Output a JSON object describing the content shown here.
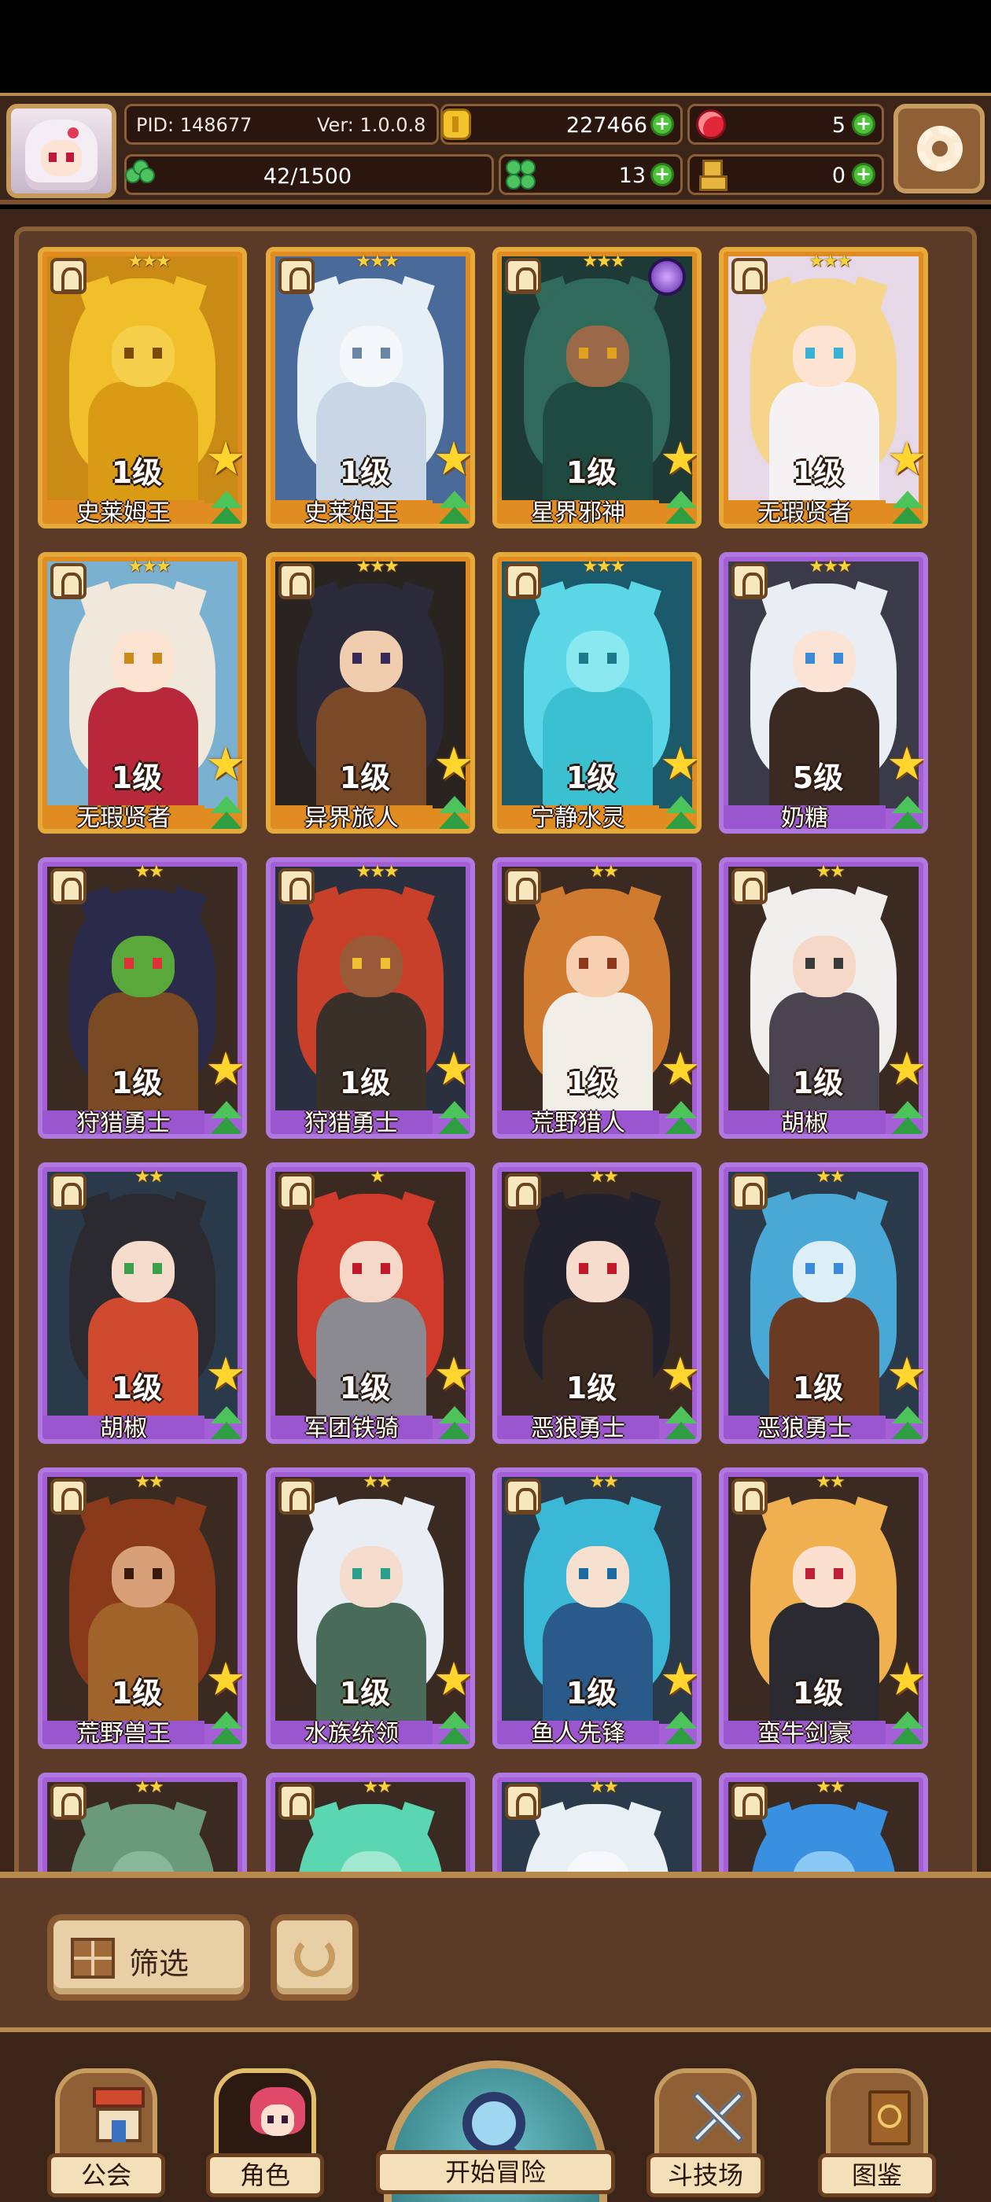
{
  "header": {
    "pid": "PID: 148677",
    "version": "Ver: 1.0.0.8",
    "gold": "227466",
    "gems": "5",
    "capacity": "42/1500",
    "clover": "13",
    "boots": "0"
  },
  "heroes": [
    {
      "name": "史莱姆王",
      "level": "1级",
      "stars": "★★★",
      "rarity": "gold",
      "palette": {
        "bg": "#c98a16",
        "hair": "#f1bf2a",
        "skin": "#f6cf4a",
        "body": "#d99a14",
        "eye": "#7a4a08"
      }
    },
    {
      "name": "史莱姆王",
      "level": "1级",
      "stars": "★★★",
      "rarity": "gold",
      "palette": {
        "bg": "#4a6a9a",
        "hair": "#e6eef6",
        "skin": "#f4f8fb",
        "body": "#c8d6e6",
        "eye": "#6a86a6"
      }
    },
    {
      "name": "星界邪神",
      "level": "1级",
      "stars": "★★★",
      "rarity": "gold",
      "palette": {
        "bg": "#1e3a36",
        "hair": "#2f6a5a",
        "skin": "#9a6a48",
        "body": "#1f4a40",
        "eye": "#e0a020"
      }
    },
    {
      "name": "无瑕贤者",
      "level": "1级",
      "stars": "★★★",
      "rarity": "gold",
      "palette": {
        "bg": "#e6d8e6",
        "hair": "#f6d58a",
        "skin": "#fde4d2",
        "body": "#f6f2f4",
        "eye": "#3ab0d6"
      }
    },
    {
      "name": "无瑕贤者",
      "level": "1级",
      "stars": "★★★",
      "rarity": "gold",
      "palette": {
        "bg": "#7ab0d0",
        "hair": "#f1e8dc",
        "skin": "#fde4d2",
        "body": "#b8283a",
        "eye": "#c88a1a"
      }
    },
    {
      "name": "异界旅人",
      "level": "1级",
      "stars": "★★★",
      "rarity": "gold",
      "palette": {
        "bg": "#2a2420",
        "hair": "#2a2a3a",
        "skin": "#f1cdb0",
        "body": "#7a4a28",
        "eye": "#3a2a5a"
      }
    },
    {
      "name": "宁静水灵",
      "level": "1级",
      "stars": "★★★",
      "rarity": "gold",
      "palette": {
        "bg": "#1a5a6a",
        "hair": "#5ad6e6",
        "skin": "#8ae8f0",
        "body": "#3ac0d0",
        "eye": "#1a7a8a"
      }
    },
    {
      "name": "奶糖",
      "level": "5级",
      "stars": "★★★",
      "rarity": "purple",
      "palette": {
        "bg": "#3a3a48",
        "hair": "#e8eef4",
        "skin": "#fbe4d6",
        "body": "#3a2a22",
        "eye": "#3a8ad6"
      }
    },
    {
      "name": "狩猎勇士",
      "level": "1级",
      "stars": "★★",
      "rarity": "purple",
      "palette": {
        "bg": "#3a2a22",
        "hair": "#2a2a4a",
        "skin": "#5aa83a",
        "body": "#7a4a22",
        "eye": "#e0303a"
      }
    },
    {
      "name": "狩猎勇士",
      "level": "1级",
      "stars": "★★★",
      "rarity": "purple",
      "palette": {
        "bg": "#2a3040",
        "hair": "#c8402a",
        "skin": "#9a5a38",
        "body": "#3a302a",
        "eye": "#f0c030"
      }
    },
    {
      "name": "荒野猎人",
      "level": "1级",
      "stars": "★★",
      "rarity": "purple",
      "palette": {
        "bg": "#3a2a22",
        "hair": "#d07a30",
        "skin": "#f6d0b0",
        "body": "#f1eee8",
        "eye": "#8a3a1a"
      }
    },
    {
      "name": "胡椒",
      "level": "1级",
      "stars": "★★",
      "rarity": "purple",
      "palette": {
        "bg": "#3a2a22",
        "hair": "#f1eeee",
        "skin": "#f6d8c8",
        "body": "#4a4450",
        "eye": "#3a3a3a"
      }
    },
    {
      "name": "胡椒",
      "level": "1级",
      "stars": "★★",
      "rarity": "purple",
      "palette": {
        "bg": "#2a3a4a",
        "hair": "#2a2a30",
        "skin": "#f6dccc",
        "body": "#d04a30",
        "eye": "#3aa04a"
      }
    },
    {
      "name": "军团铁骑",
      "level": "1级",
      "stars": "★",
      "rarity": "purple",
      "palette": {
        "bg": "#3a2a22",
        "hair": "#d03a2a",
        "skin": "#f6d8c8",
        "body": "#8a8a90",
        "eye": "#c01a2a"
      }
    },
    {
      "name": "恶狼勇士",
      "level": "1级",
      "stars": "★★",
      "rarity": "purple",
      "palette": {
        "bg": "#3a2a22",
        "hair": "#22222e",
        "skin": "#f6dccc",
        "body": "#3a2a22",
        "eye": "#c01a2a"
      }
    },
    {
      "name": "恶狼勇士",
      "level": "1级",
      "stars": "★★",
      "rarity": "purple",
      "palette": {
        "bg": "#2a3a4a",
        "hair": "#4aa8d6",
        "skin": "#dceef6",
        "body": "#6a3a22",
        "eye": "#3a8ad6"
      }
    },
    {
      "name": "荒野兽王",
      "level": "1级",
      "stars": "★★",
      "rarity": "purple",
      "palette": {
        "bg": "#3a2a22",
        "hair": "#8a3a1a",
        "skin": "#d8a078",
        "body": "#a0642a",
        "eye": "#3a1a0a"
      }
    },
    {
      "name": "水族统领",
      "level": "1级",
      "stars": "★★",
      "rarity": "purple",
      "palette": {
        "bg": "#3a2a22",
        "hair": "#e8eef4",
        "skin": "#f6dccc",
        "body": "#4a6a5a",
        "eye": "#2aa08a"
      }
    },
    {
      "name": "鱼人先锋",
      "level": "1级",
      "stars": "★★",
      "rarity": "purple",
      "palette": {
        "bg": "#2a3a4a",
        "hair": "#3ab8d6",
        "skin": "#f6e0d0",
        "body": "#2a5a8a",
        "eye": "#1a6aa0"
      }
    },
    {
      "name": "蛮牛剑豪",
      "level": "1级",
      "stars": "★★",
      "rarity": "purple",
      "palette": {
        "bg": "#3a2a22",
        "hair": "#f0b050",
        "skin": "#fbe0d0",
        "body": "#2a2a30",
        "eye": "#c0203a"
      }
    },
    {
      "name": "",
      "level": "",
      "stars": "★★",
      "rarity": "purple",
      "palette": {
        "bg": "#3a2a22",
        "hair": "#6a9a7a",
        "skin": "#8ab89a",
        "body": "#4a7a5a",
        "eye": "#2a4a3a"
      }
    },
    {
      "name": "",
      "level": "",
      "stars": "★★",
      "rarity": "purple",
      "palette": {
        "bg": "#3a2a22",
        "hair": "#5ad6b0",
        "skin": "#a0e8d0",
        "body": "#3ab090",
        "eye": "#1a6a5a"
      }
    },
    {
      "name": "",
      "level": "",
      "stars": "★★",
      "rarity": "purple",
      "palette": {
        "bg": "#2a3a4a",
        "hair": "#e8f0f6",
        "skin": "#f6f8fb",
        "body": "#c8d8e6",
        "eye": "#4a6a8a"
      }
    },
    {
      "name": "",
      "level": "",
      "stars": "★★",
      "rarity": "purple",
      "palette": {
        "bg": "#3a2a22",
        "hair": "#3a90e0",
        "skin": "#8ac8f6",
        "body": "#2a70c0",
        "eye": "#1a3a6a"
      }
    }
  ],
  "toolbar": {
    "filter_label": "筛选"
  },
  "nav": {
    "guild": "公会",
    "characters": "角色",
    "adventure": "开始冒险",
    "arena": "斗技场",
    "codex": "图鉴"
  }
}
